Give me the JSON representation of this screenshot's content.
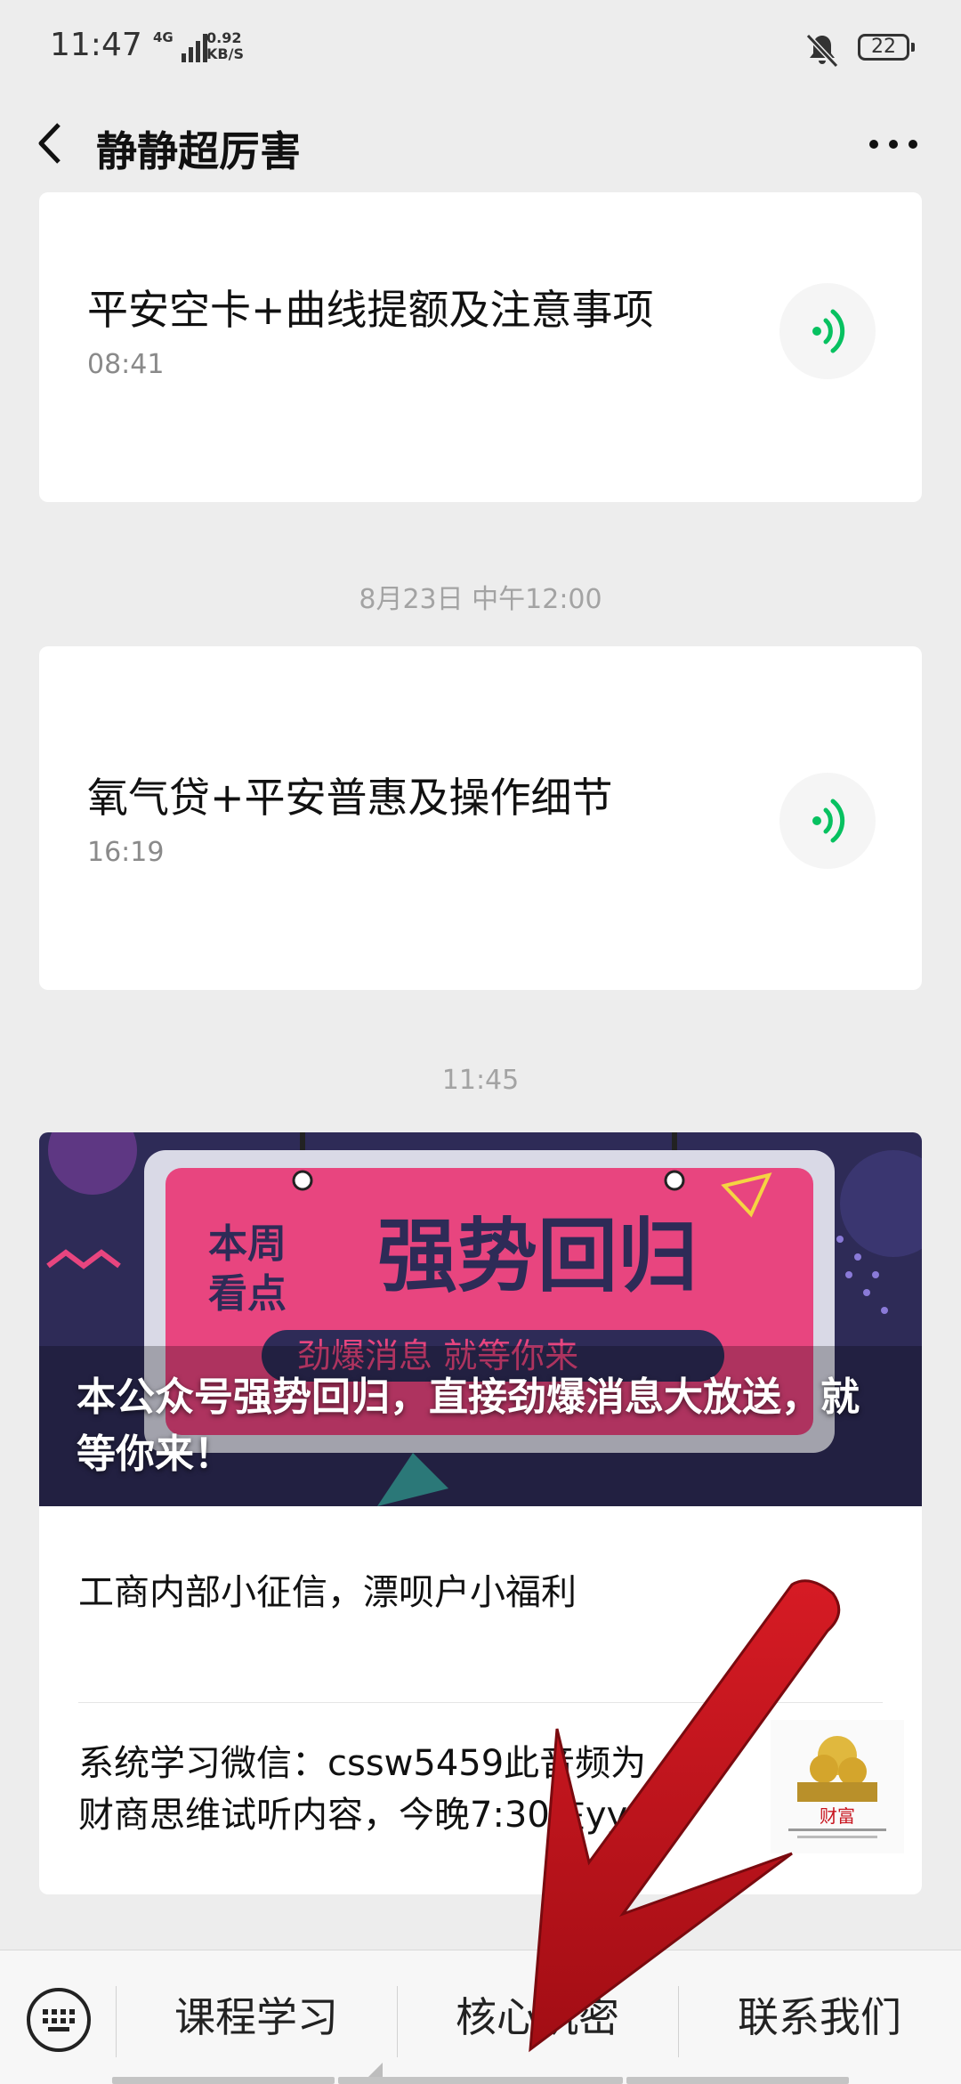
{
  "status_bar": {
    "time": "11:47",
    "network": "4G",
    "speed_value": "0.92",
    "speed_unit": "KB/S",
    "battery": "22"
  },
  "nav": {
    "title": "静静超厉害",
    "back_icon": "chevron-left-icon",
    "more_icon": "ellipsis-icon"
  },
  "messages": [
    {
      "type": "audio",
      "title": "平安空卡+曲线提额及注意事项",
      "duration": "08:41"
    },
    {
      "type": "divider",
      "text": "8月23日 中午12:00"
    },
    {
      "type": "audio",
      "title": "氧气贷+平安普惠及操作细节",
      "duration": "16:19"
    },
    {
      "type": "divider",
      "text": "11:45"
    }
  ],
  "article": {
    "cover_title": "本公众号强势回归，直接劲爆消息大放送，就等你来！",
    "cover_art": {
      "line1": "本周",
      "line2": "看点",
      "headline": "强势回归",
      "subline": "劲爆消息 就等你来"
    },
    "items": [
      {
        "title": "工商内部小征信，漂呗户小福利"
      },
      {
        "title_line1": "系统学习微信：cssw5459此音频为",
        "title_line2": "财商思维试听内容，今晚7:30在yy:",
        "thumb_text": "财富"
      }
    ]
  },
  "menu": {
    "keyboard_icon": "keyboard-icon",
    "items": [
      "课程学习",
      "核心机密",
      "联系我们"
    ]
  },
  "colors": {
    "background": "#ededed",
    "accent_green": "#07c160",
    "annotation_red": "#c8141e",
    "cover_pink": "#e8457f",
    "cover_navy": "#2e2b57"
  }
}
